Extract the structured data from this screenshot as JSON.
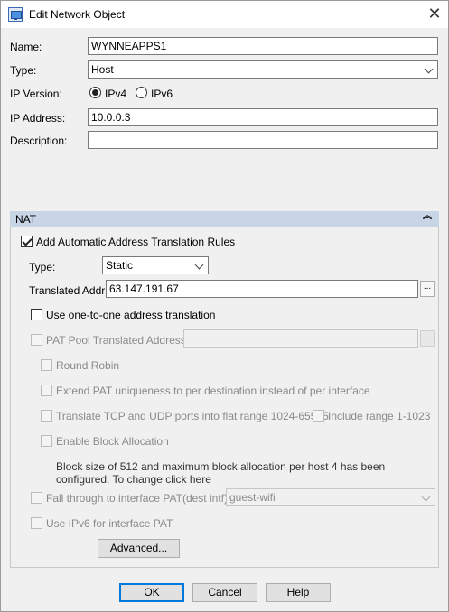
{
  "window": {
    "title": "Edit Network Object",
    "close_glyph": "✕",
    "app_icon": "network-object-icon"
  },
  "form": {
    "name_label": "Name:",
    "name_value": "WYNNEAPPS1",
    "type_label": "Type:",
    "type_value": "Host",
    "ipver_label": "IP Version:",
    "ipv4_label": "IPv4",
    "ipv6_label": "IPv6",
    "ip_label": "IP Address:",
    "ip_value": "10.0.0.3",
    "desc_label": "Description:",
    "desc_value": ""
  },
  "nat": {
    "header": "NAT",
    "collapse_glyph": "︽",
    "auto_rules_label": "Add Automatic Address Translation Rules",
    "type_label": "Type:",
    "type_value": "Static",
    "translated_label": "Translated Addr:",
    "translated_value": "63.147.191.67",
    "browse_glyph": "...",
    "one_to_one_label": "Use one-to-one address translation",
    "pat_pool_label": "PAT Pool Translated Address:",
    "pat_pool_value": "",
    "round_robin_label": "Round Robin",
    "extend_pat_label": "Extend PAT uniqueness to per destination instead of per interface",
    "translate_ports_label": "Translate TCP and UDP ports into flat range 1024-65535",
    "include_range_label": "Include range 1-1023",
    "block_alloc_label": "Enable Block Allocation",
    "block_note": "Block size of 512 and maximum block allocation per host 4 has been configured. To change click here",
    "fallthrough_label": "Fall through to interface PAT(dest intf):",
    "fallthrough_value": "guest-wifi",
    "ipv6_pat_label": "Use IPv6 for interface PAT",
    "advanced_label": "Advanced..."
  },
  "buttons": {
    "ok": "OK",
    "cancel": "Cancel",
    "help": "Help"
  },
  "colors": {
    "nat_header_bg": "#c7d5e6",
    "default_button_border": "#0078d7",
    "disabled_text": "#8a8a8a"
  }
}
